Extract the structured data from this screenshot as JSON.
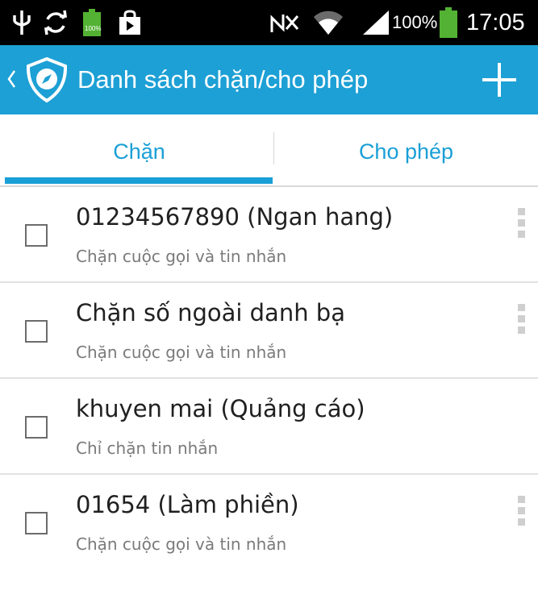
{
  "status_bar": {
    "battery_percent": "100%",
    "battery_small_label": "100%",
    "time": "17:05",
    "icons": [
      "usb-icon",
      "sync-icon",
      "battery-small-icon",
      "shopping-bag-icon",
      "nfc-icon",
      "wifi-icon",
      "signal-icon",
      "battery-icon"
    ]
  },
  "action_bar": {
    "title": "Danh sách chặn/cho phép",
    "background_color": "#1da0d5",
    "icons": [
      "back-chevron-icon",
      "shield-logo-icon",
      "add-icon"
    ]
  },
  "tabs": [
    {
      "label": "Chặn",
      "selected": true
    },
    {
      "label": "Cho phép",
      "selected": false
    }
  ],
  "accent_color": "#1a9fd6",
  "list": [
    {
      "title": "01234567890 (Ngan hang)",
      "subtitle": "Chặn cuộc gọi và tin nhắn",
      "checked": false,
      "has_menu": true
    },
    {
      "title": "Chặn số ngoài danh bạ",
      "subtitle": "Chặn cuộc gọi và tin nhắn",
      "checked": false,
      "has_menu": true
    },
    {
      "title": "khuyen mai (Quảng cáo)",
      "subtitle": "Chỉ chặn tin nhắn",
      "checked": false,
      "has_menu": false
    },
    {
      "title": "01654 (Làm phiền)",
      "subtitle": "Chặn cuộc gọi và tin nhắn",
      "checked": false,
      "has_menu": true
    }
  ]
}
